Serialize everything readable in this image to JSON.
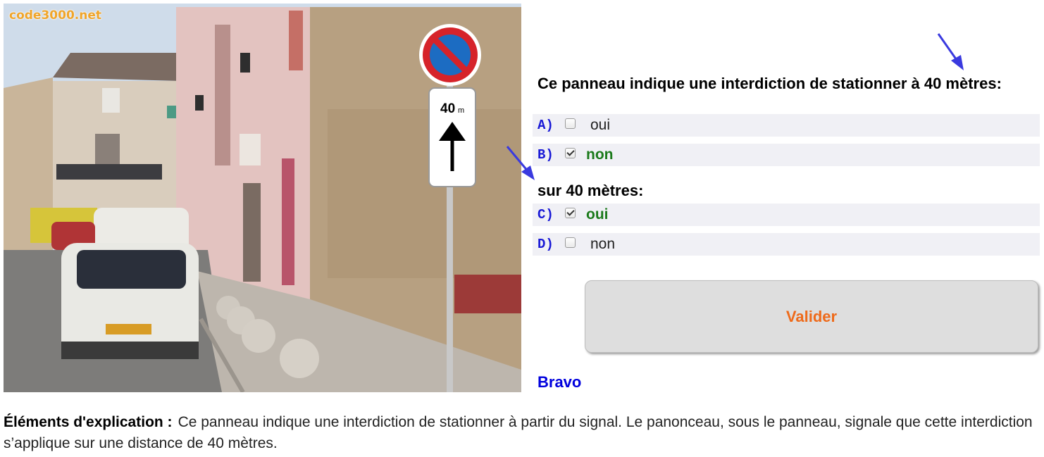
{
  "photo": {
    "watermark": "code3000.net",
    "sign_panel_text": "40",
    "sign_panel_unit": "m"
  },
  "question": {
    "title": "Ce panneau indique une interdiction de stationner à 40 mètres:",
    "subtitle": "sur 40 mètres:",
    "answers": [
      {
        "letter": "A)",
        "text": "oui",
        "checked": false,
        "correct": false
      },
      {
        "letter": "B)",
        "text": "non",
        "checked": true,
        "correct": true
      },
      {
        "letter": "C)",
        "text": "oui",
        "checked": true,
        "correct": true
      },
      {
        "letter": "D)",
        "text": "non",
        "checked": false,
        "correct": false
      }
    ]
  },
  "submit": {
    "label": "Valider"
  },
  "result": {
    "message": "Bravo"
  },
  "explanation": {
    "label": "Éléments d'explication :",
    "text": "Ce panneau indique une interdiction de stationner à partir du signal. Le panonceau, sous le panneau, signale que cette interdiction s’applique sur une distance de 40 mètres."
  },
  "colors": {
    "letter": "#1a1ad6",
    "correct_answer": "#1b7a1b",
    "valider_text": "#ee6a1a",
    "bravo": "#0000dd",
    "pointer_arrow": "#3a3adf"
  }
}
